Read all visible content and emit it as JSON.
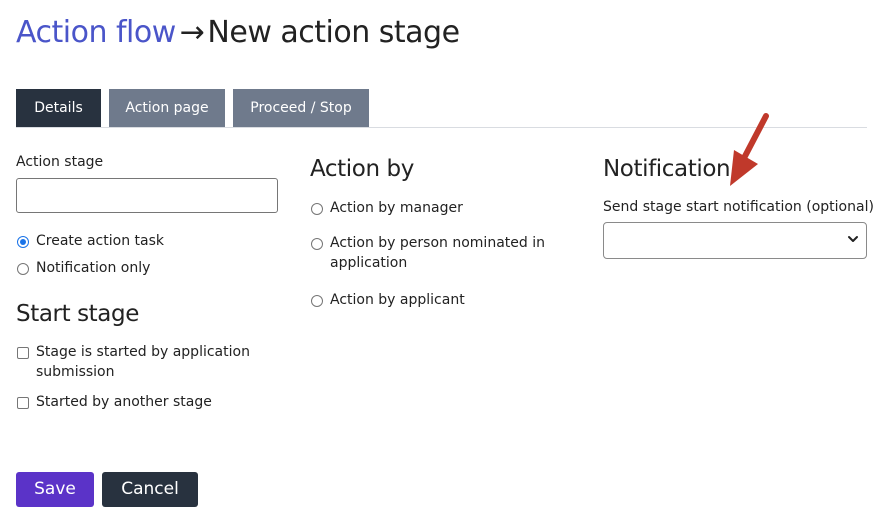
{
  "breadcrumb": {
    "parent": "Action flow",
    "arrow": "→",
    "current": "New action stage"
  },
  "tabs": [
    {
      "label": "Details",
      "active": true
    },
    {
      "label": "Action page",
      "active": false
    },
    {
      "label": "Proceed / Stop",
      "active": false
    }
  ],
  "details": {
    "action_stage_label": "Action stage",
    "action_stage_value": "",
    "type_options": [
      {
        "label": "Create action task",
        "selected": true
      },
      {
        "label": "Notification only",
        "selected": false
      }
    ]
  },
  "start_stage": {
    "heading": "Start stage",
    "options": [
      {
        "label_line1": "Stage is started by application",
        "label_line2": "submission",
        "checked": false
      },
      {
        "label": "Started by another stage",
        "checked": false
      }
    ]
  },
  "action_by": {
    "heading": "Action by",
    "options": [
      {
        "label": "Action by manager",
        "selected": false
      },
      {
        "label_line1": "Action by person nominated in",
        "label_line2": "application",
        "selected": false
      },
      {
        "label": "Action by applicant",
        "selected": false
      }
    ]
  },
  "notification": {
    "heading": "Notification",
    "select_label": "Send stage start notification (optional)",
    "select_value": ""
  },
  "buttons": {
    "save": "Save",
    "cancel": "Cancel"
  },
  "colors": {
    "link": "#4a55c9",
    "tab_active": "#28323f",
    "tab_inactive": "#6f7a8c",
    "save_button": "#5b33c8",
    "cancel_button": "#28323f",
    "radio_selected": "#1a73e8",
    "annotation_arrow": "#c0392b"
  },
  "icons": {
    "select_chevron": "chevron-down-icon",
    "annotation": "red-arrow-annotation"
  }
}
